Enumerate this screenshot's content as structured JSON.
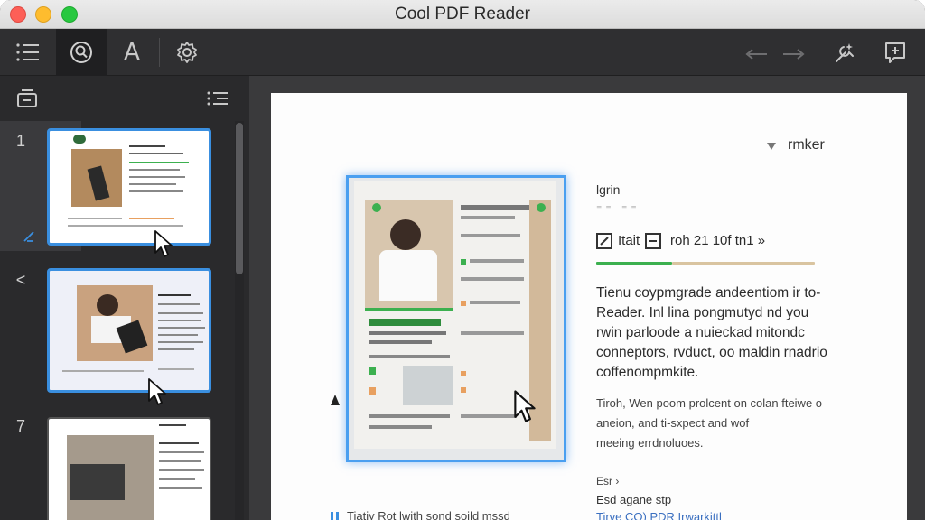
{
  "window": {
    "title": "Cool PDF Reader"
  },
  "toolbar": {
    "buttons": [
      "toc-icon",
      "search-icon",
      "font-icon",
      "settings-icon",
      "back-icon",
      "forward-icon",
      "tools-icon",
      "add-annotation-icon"
    ],
    "font_label": "A"
  },
  "sidebar": {
    "pages": [
      {
        "number": "1",
        "selected": true
      },
      {
        "number": "<",
        "selected": true
      },
      {
        "number": "7",
        "selected": false
      }
    ]
  },
  "document": {
    "tag": "rmker",
    "login_label": "lgrin",
    "login_sub": "⁼⁼   ⁼⁼",
    "meta_a": "Itait",
    "meta_b": "roh 21 10f tn1 »",
    "para1": [
      "Tienu coypmgrade  andeentiom ir  to-",
      "Reader.  Inl lina pongmutyd nd you",
      "rwin parloode a nuieckad mitondc",
      "conneptors, rvduct, oo maldin rnadrio",
      "coffenompmkite."
    ],
    "para2": [
      "Tiroh, Wen poom prolcent on colan fteiwe o",
      "aneion, and ti-sxpect and wof",
      "meeing errdnoluoes."
    ],
    "foot1": "Esr ›",
    "foot2": "Esd agane stp",
    "foot3": "Tirve CO) PDR Irwarkittl",
    "bottom_note": "Tiatiy Rot lwith sond soild mssd"
  },
  "colors": {
    "accent": "#3a8fe0",
    "progress_green": "#3cb04f",
    "progress_tan": "#d9c4a0"
  }
}
